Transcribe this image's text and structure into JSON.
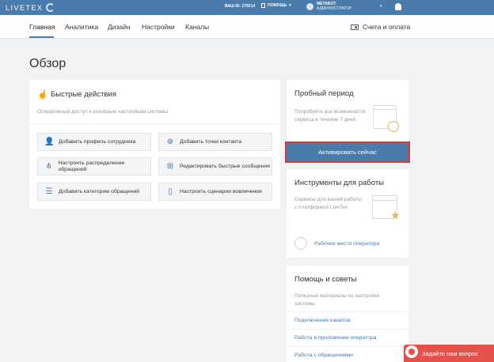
{
  "topbar": {
    "logo": "LIVETEX",
    "account_id": "ВАШ ID: 279214",
    "help": "ПОМОЩЬ",
    "user_name": "МЕТАБОТ",
    "user_role": "АДМИНИСТРАТОР"
  },
  "nav": {
    "items": [
      "Главная",
      "Аналитика",
      "Дизайн",
      "Настройки",
      "Каналы"
    ],
    "billing": "Счета и оплата"
  },
  "page": {
    "title": "Обзор"
  },
  "quick_actions": {
    "title": "Быстрые действия",
    "subtitle": "Оперативный доступ к основным настройкам системы",
    "buttons": [
      "Добавить профиль сотрудника",
      "Добавить точки контакта",
      "Настроить распределение обращений",
      "Редактировать быстрые сообщения",
      "Добавить категорию обращений",
      "Настроить сценарии вовлечения"
    ]
  },
  "trial": {
    "title": "Пробный период",
    "text": "Попробуйте все возможности сервиса в течение 7 дней",
    "button": "Активировать сейчас"
  },
  "tools": {
    "title": "Инструменты для работы",
    "text": "Сервисы для вашей работы с платформой LiveTex",
    "link": "Рабочее место оператора"
  },
  "help_panel": {
    "title": "Помощь и советы",
    "text": "Полезные материалы по настройке системы",
    "links": [
      "Подключение каналов",
      "Работа в приложении оператора",
      "Работа с обращениями"
    ]
  },
  "chat": {
    "label": "Задайте нам вопрос"
  },
  "colors": {
    "accent": "#4a7bab",
    "highlight": "#d9363e",
    "chat": "#e5504a",
    "icon_yellow": "#e8b84a"
  }
}
